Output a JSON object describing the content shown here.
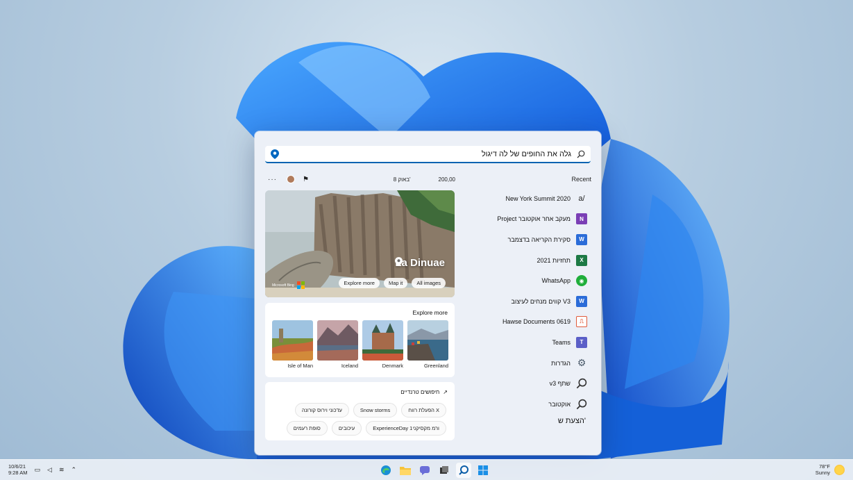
{
  "search": {
    "query": "גלה את החופים של לה דיגול"
  },
  "recent": {
    "heading": "Recent",
    "items": [
      {
        "label": "New York Summit 2020",
        "icon": "word-document-icon",
        "color": "#ffffff",
        "glyph": "a"
      },
      {
        "label": "Project מעקב אחר אוקטובר",
        "icon": "onenote-icon",
        "color": "#7b3fb5",
        "glyph": "N"
      },
      {
        "label": "סקירת הקריאה בדצמבר",
        "icon": "word-icon",
        "color": "#2b6cd8",
        "glyph": "W"
      },
      {
        "label": "2021 תחזיות",
        "icon": "excel-icon",
        "color": "#1d7a45",
        "glyph": "X"
      },
      {
        "label": "WhatsApp",
        "icon": "whatsapp-icon",
        "color": "#1fae3b",
        "glyph": "◉"
      },
      {
        "label": "קווים מנחים לעיצוב V3",
        "icon": "word-icon",
        "color": "#2b6cd8",
        "glyph": "W"
      },
      {
        "label": "Hawse Documents 0619",
        "icon": "pdf-icon",
        "color": "#e05a3a",
        "glyph": "⎍"
      },
      {
        "label": "Teams",
        "icon": "teams-icon",
        "color": "#5b5fc7",
        "glyph": "T"
      },
      {
        "label": "הגדרות",
        "icon": "settings-gear-icon",
        "color": "#4a5a6a",
        "glyph": "⚙"
      },
      {
        "label": "v3 שתף",
        "icon": "search-icon",
        "color": "transparent",
        "glyph": "⌕"
      },
      {
        "label": "אוקטובר",
        "icon": "search-icon",
        "color": "transparent",
        "glyph": "⌕"
      }
    ],
    "suggest_heading": "הצעת ש'"
  },
  "toprow": {
    "stat1": "200,00",
    "stat2": "8 באוק'",
    "more": "···"
  },
  "hero": {
    "title": "La Dinuae",
    "buttons": [
      "All images",
      "Map it",
      "Explore more"
    ],
    "brand": "Microsoft Bing"
  },
  "explore": {
    "heading": "Explore more",
    "tiles": [
      "Greenland",
      "Denmark",
      "Iceland",
      "Isle of Man"
    ]
  },
  "trending": {
    "heading": "חיפושים טרנדיים",
    "row1": [
      "הפעלת רווח X",
      "Snow storms",
      "עדכוני וירוס קורונה"
    ],
    "row2": [
      "ExperienceDay 1ורמ מקסיקני",
      "עיכובים",
      "סופת רעמים"
    ]
  },
  "taskbar": {
    "weather_temp": "78°F",
    "weather_text": "Sunny",
    "date": "10/6/21",
    "time": "9:28 AM"
  }
}
